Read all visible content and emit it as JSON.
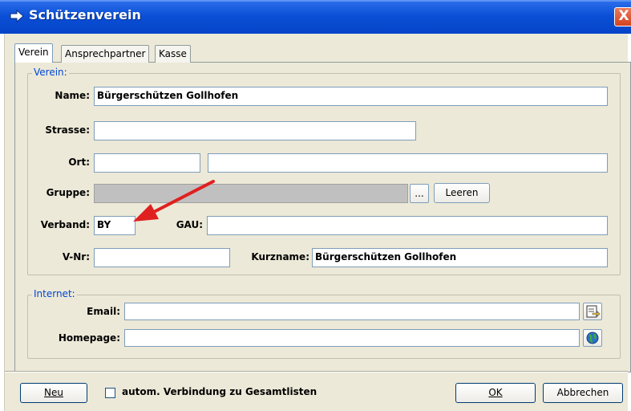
{
  "window": {
    "title": "Schützenverein",
    "close_glyph": "X"
  },
  "tabs": [
    {
      "label": "Verein",
      "active": true
    },
    {
      "label": "Ansprechpartner",
      "active": false
    },
    {
      "label": "Kasse",
      "active": false
    }
  ],
  "verein": {
    "legend": "Verein:",
    "name_label": "Name:",
    "name_value": "Bürgerschützen Gollhofen",
    "strasse_label": "Strasse:",
    "strasse_value": "",
    "ort_label": "Ort:",
    "plz_value": "",
    "ort_value": "",
    "gruppe_label": "Gruppe:",
    "gruppe_value": "",
    "browse_label": "...",
    "leeren_label": "Leeren",
    "verband_label": "Verband:",
    "verband_value": "BY",
    "gau_label": "GAU:",
    "gau_value": "",
    "vnr_label": "V-Nr:",
    "vnr_value": "",
    "kurzname_label": "Kurzname:",
    "kurzname_value": "Bürgerschützen Gollhofen"
  },
  "internet": {
    "legend": "Internet:",
    "email_label": "Email:",
    "email_value": "",
    "homepage_label": "Homepage:",
    "homepage_value": ""
  },
  "footer": {
    "neu_label": "Neu",
    "checkbox_label": "autom. Verbindung zu Gesamtlisten",
    "checkbox_checked": false,
    "ok_label": "OK",
    "abbrechen_label": "Abbrechen"
  },
  "colors": {
    "title_bar": "#0a4fd6",
    "legend_text": "#0046d5",
    "annotation_arrow": "#e02020"
  },
  "icons": {
    "title": "arrow-right-icon",
    "email_button": "compose-mail-icon",
    "homepage_button": "globe-icon"
  }
}
